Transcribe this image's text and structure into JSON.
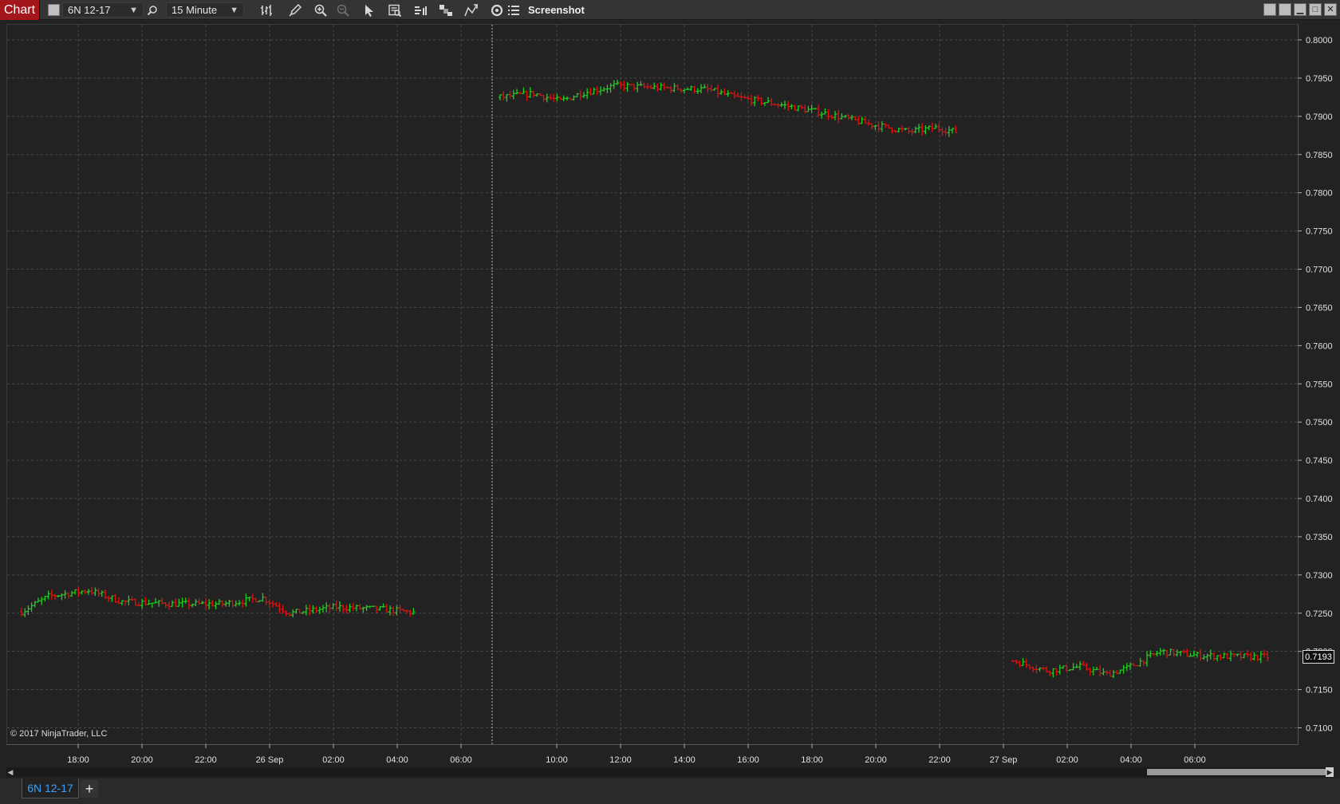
{
  "toolbar": {
    "chart_label": "Chart",
    "instrument": "6N 12-17",
    "interval": "15 Minute",
    "screenshot_label": "Screenshot",
    "icons": [
      "color-swatch",
      "instrument-search",
      "bar-type",
      "draw-pencil",
      "zoom-in",
      "zoom-out",
      "pointer",
      "data-box",
      "strategies",
      "indicators",
      "chart-trader",
      "refresh",
      "properties-list"
    ]
  },
  "window_controls": [
    "tile",
    "restore",
    "minimize",
    "maximize",
    "close"
  ],
  "chart": {
    "copyright": "© 2017 NinjaTrader, LLC",
    "current_price": "0.7193",
    "colors": {
      "up": "#22cc22",
      "down": "#e01010",
      "background": "#222222",
      "grid": "#4a4a4a"
    }
  },
  "chart_data": {
    "type": "ohlc",
    "y_ticks": [
      "0.8000",
      "0.7950",
      "0.7900",
      "0.7850",
      "0.7800",
      "0.7750",
      "0.7700",
      "0.7650",
      "0.7600",
      "0.7550",
      "0.7500",
      "0.7450",
      "0.7400",
      "0.7350",
      "0.7300",
      "0.7250",
      "0.7200",
      "0.7150",
      "0.7100"
    ],
    "x_ticks": [
      "18:00",
      "20:00",
      "22:00",
      "26 Sep",
      "02:00",
      "04:00",
      "06:00",
      "10:00",
      "12:00",
      "14:00",
      "16:00",
      "18:00",
      "20:00",
      "22:00",
      "27 Sep",
      "02:00",
      "04:00",
      "06:00"
    ],
    "ylim": [
      0.709,
      0.801
    ],
    "segments": [
      {
        "anchors": [
          [
            0,
            0.7252
          ],
          [
            8,
            0.7272
          ],
          [
            20,
            0.728
          ],
          [
            30,
            0.7265
          ],
          [
            46,
            0.7262
          ],
          [
            60,
            0.7262
          ],
          [
            72,
            0.727
          ],
          [
            80,
            0.725
          ],
          [
            94,
            0.7258
          ],
          [
            108,
            0.7255
          ],
          [
            117,
            0.7251
          ]
        ]
      },
      {
        "anchors": [
          [
            0,
            0.7925
          ],
          [
            10,
            0.793
          ],
          [
            18,
            0.792
          ],
          [
            24,
            0.793
          ],
          [
            34,
            0.794
          ],
          [
            50,
            0.7937
          ],
          [
            62,
            0.7935
          ],
          [
            70,
            0.7925
          ],
          [
            84,
            0.7915
          ],
          [
            98,
            0.7903
          ],
          [
            110,
            0.789
          ],
          [
            122,
            0.788
          ],
          [
            130,
            0.7885
          ],
          [
            136,
            0.788
          ]
        ]
      },
      {
        "anchors": [
          [
            0,
            0.7188
          ],
          [
            10,
            0.7175
          ],
          [
            20,
            0.718
          ],
          [
            28,
            0.717
          ],
          [
            34,
            0.7178
          ],
          [
            44,
            0.72
          ],
          [
            54,
            0.7195
          ],
          [
            68,
            0.7193
          ],
          [
            76,
            0.7193
          ]
        ]
      }
    ]
  }
}
